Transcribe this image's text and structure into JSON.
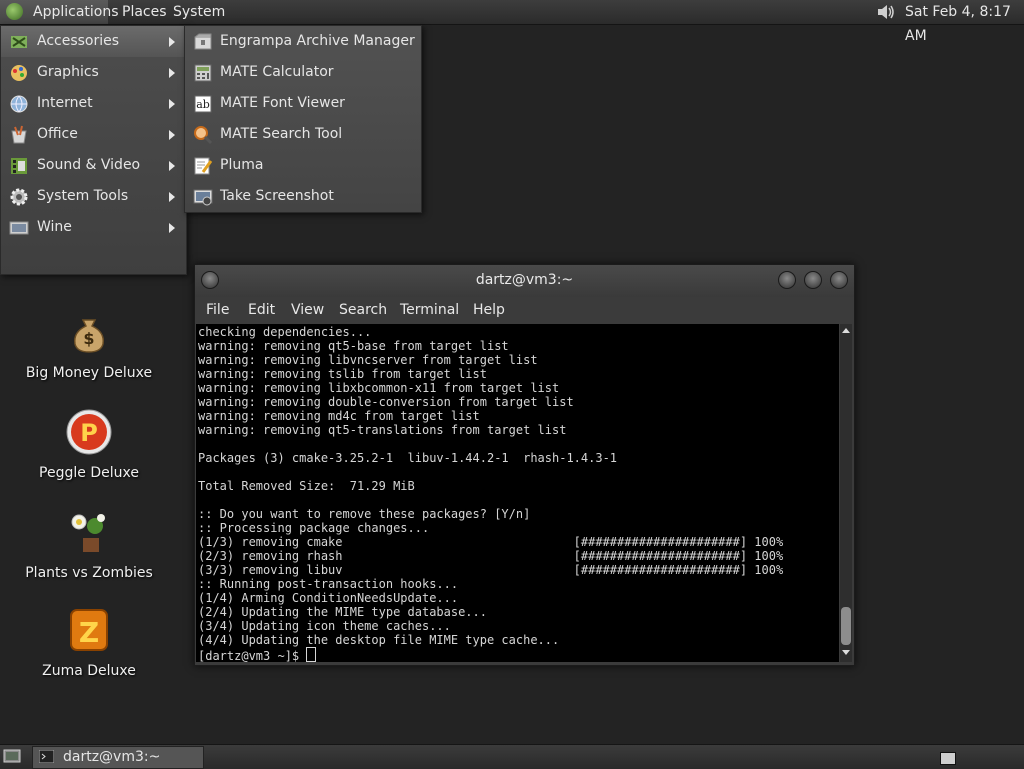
{
  "top_panel": {
    "applications": "Applications",
    "places": "Places",
    "system": "System",
    "clock": "Sat Feb  4,  8:17 AM"
  },
  "app_menu": {
    "items": [
      {
        "label": "Accessories",
        "icon": "accessories-icon"
      },
      {
        "label": "Graphics",
        "icon": "graphics-icon"
      },
      {
        "label": "Internet",
        "icon": "internet-icon"
      },
      {
        "label": "Office",
        "icon": "office-icon"
      },
      {
        "label": "Sound & Video",
        "icon": "sound-video-icon"
      },
      {
        "label": "System Tools",
        "icon": "system-tools-icon"
      },
      {
        "label": "Wine",
        "icon": "wine-icon"
      }
    ]
  },
  "submenu": {
    "items": [
      {
        "label": "Engrampa Archive Manager",
        "icon": "archive-icon"
      },
      {
        "label": "MATE Calculator",
        "icon": "calculator-icon"
      },
      {
        "label": "MATE Font Viewer",
        "icon": "font-viewer-icon"
      },
      {
        "label": "MATE Search Tool",
        "icon": "search-icon"
      },
      {
        "label": "Pluma",
        "icon": "text-editor-icon"
      },
      {
        "label": "Take Screenshot",
        "icon": "screenshot-icon"
      }
    ]
  },
  "desktop": {
    "icons": [
      {
        "label": "Big Money Deluxe",
        "icon": "money-bag-icon"
      },
      {
        "label": "Peggle Deluxe",
        "icon": "peggle-icon"
      },
      {
        "label": "Plants vs Zombies",
        "icon": "plants-icon"
      },
      {
        "label": "Zuma Deluxe",
        "icon": "zuma-icon"
      }
    ]
  },
  "terminal": {
    "title": "dartz@vm3:~",
    "menu": [
      "File",
      "Edit",
      "View",
      "Search",
      "Terminal",
      "Help"
    ],
    "output": "checking dependencies...\nwarning: removing qt5-base from target list\nwarning: removing libvncserver from target list\nwarning: removing tslib from target list\nwarning: removing libxbcommon-x11 from target list\nwarning: removing double-conversion from target list\nwarning: removing md4c from target list\nwarning: removing qt5-translations from target list\n\nPackages (3) cmake-3.25.2-1  libuv-1.44.2-1  rhash-1.4.3-1\n\nTotal Removed Size:  71.29 MiB\n\n:: Do you want to remove these packages? [Y/n]\n:: Processing package changes...\n(1/3) removing cmake                                [######################] 100%\n(2/3) removing rhash                                [######################] 100%\n(3/3) removing libuv                                [######################] 100%\n:: Running post-transaction hooks...\n(1/4) Arming ConditionNeedsUpdate...\n(2/4) Updating the MIME type database...\n(3/4) Updating icon theme caches...\n(4/4) Updating the desktop file MIME type cache...",
    "prompt": "[dartz@vm3 ~]$ "
  },
  "bottom_panel": {
    "task_label": "dartz@vm3:~"
  }
}
